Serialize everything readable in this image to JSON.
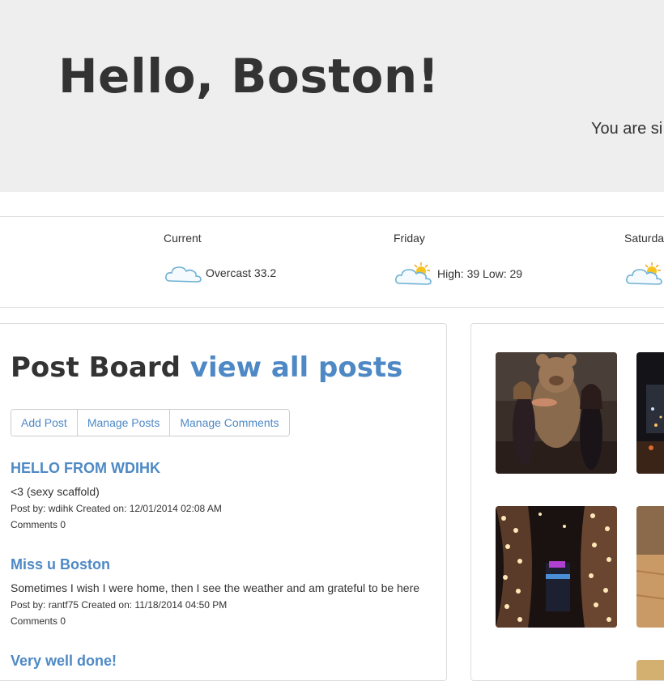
{
  "hero": {
    "title": "Hello, Boston!",
    "subtitle": "You are si"
  },
  "weather": {
    "days": [
      {
        "label": "Current",
        "icon": "overcast-cloud-icon",
        "text": "Overcast 33.2"
      },
      {
        "label": "Friday",
        "icon": "partly-sunny-icon",
        "text": "High: 39 Low: 29"
      },
      {
        "label": "Saturda",
        "icon": "partly-sunny-icon",
        "text": ""
      }
    ]
  },
  "post_board": {
    "title": "Post Board",
    "link": "view all posts",
    "buttons": {
      "add": "Add Post",
      "manage_posts": "Manage Posts",
      "manage_comments": "Manage Comments"
    },
    "posts": [
      {
        "title": "HELLO FROM WDIHK",
        "body": "<3 (sexy scaffold)",
        "meta": "Post by: wdihk Created on: 12/01/2014 02:08 AM",
        "comments": "Comments 0"
      },
      {
        "title": "Miss u Boston",
        "body": "Sometimes I wish I were home, then I see the weather and am grateful to be here",
        "meta": "Post by: rantf75 Created on: 11/18/2014 04:50 PM",
        "comments": "Comments 0"
      },
      {
        "title": "Very well done!",
        "body": "",
        "meta": "",
        "comments": ""
      }
    ]
  },
  "photos": {
    "icons": [
      "photo-bear-mascot",
      "photo-night-city",
      "photo-string-lights",
      "photo-wood-floor"
    ]
  },
  "colors": {
    "link": "#4e89c5",
    "hero_bg": "#eeeeee",
    "text": "#333333"
  }
}
